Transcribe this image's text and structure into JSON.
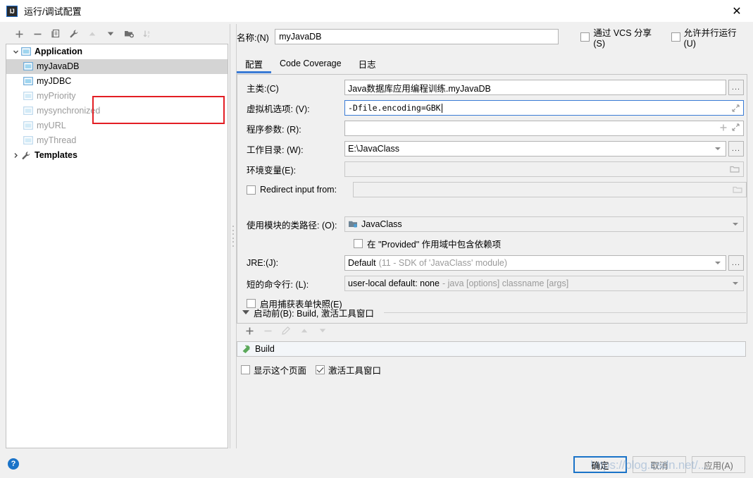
{
  "window": {
    "title": "运行/调试配置",
    "app_icon": "IJ",
    "close_icon": "✕"
  },
  "sidebar": {
    "toolbar": [
      {
        "name": "add-button",
        "icon": "plus-icon",
        "label": "+",
        "enabled": true
      },
      {
        "name": "remove-button",
        "icon": "minus-icon",
        "label": "−",
        "enabled": true
      },
      {
        "name": "copy-button",
        "icon": "copy-icon",
        "label": "copy",
        "enabled": true
      },
      {
        "name": "edit-templates-button",
        "icon": "wrench-icon",
        "label": "wrench",
        "enabled": true
      },
      {
        "name": "move-up-button",
        "icon": "arrow-up-icon",
        "label": "▲",
        "enabled": false
      },
      {
        "name": "move-down-button",
        "icon": "arrow-down-icon",
        "label": "▼",
        "enabled": true
      },
      {
        "name": "new-folder-button",
        "icon": "folder-add-icon",
        "label": "folder+",
        "enabled": true
      },
      {
        "name": "sort-button",
        "icon": "sort-alpha-icon",
        "label": "sort az",
        "enabled": false
      }
    ],
    "tree": [
      {
        "label": "Application",
        "level": 0,
        "icon": "application-icon",
        "expanded": true,
        "selected": false,
        "dim": false,
        "bold": true
      },
      {
        "label": "myJavaDB",
        "level": 1,
        "icon": "run-config-icon",
        "selected": true,
        "dim": false,
        "bold": false
      },
      {
        "label": "myJDBC",
        "level": 1,
        "icon": "run-config-icon",
        "selected": false,
        "dim": false,
        "bold": false
      },
      {
        "label": "myPriority",
        "level": 1,
        "icon": "run-config-icon",
        "selected": false,
        "dim": true,
        "bold": false
      },
      {
        "label": "mysynchronized",
        "level": 1,
        "icon": "run-config-icon",
        "selected": false,
        "dim": true,
        "bold": false
      },
      {
        "label": "myURL",
        "level": 1,
        "icon": "run-config-icon",
        "selected": false,
        "dim": true,
        "bold": false
      },
      {
        "label": "myThread",
        "level": 1,
        "icon": "run-config-icon",
        "selected": false,
        "dim": true,
        "bold": false
      },
      {
        "label": "Templates",
        "level": 0,
        "icon": "wrench-icon",
        "expanded": false,
        "selected": false,
        "dim": false,
        "bold": true
      }
    ]
  },
  "config": {
    "name_label": "名称:(N)",
    "name_value": "myJavaDB",
    "share_vcs_label": "通过 VCS 分享(S)",
    "share_vcs_checked": false,
    "allow_parallel_label": "允许并行运行(U)",
    "allow_parallel_checked": false,
    "tabs": [
      {
        "label": "配置",
        "active": true
      },
      {
        "label": "Code Coverage",
        "active": false
      },
      {
        "label": "日志",
        "active": false
      }
    ],
    "fields": {
      "main_class_label": "主类:(C)",
      "main_class_value": "Java数据库应用编程训练.myJavaDB",
      "vm_options_label": "虚拟机选项: (V):",
      "vm_options_value": "-Dfile.encoding=GBK",
      "program_args_label": "程序参数: (R):",
      "program_args_value": "",
      "working_dir_label": "工作目录: (W):",
      "working_dir_value": "E:\\JavaClass",
      "env_vars_label": "环境变量(E):",
      "env_vars_value": "",
      "redirect_input_label": "Redirect input from:",
      "redirect_input_checked": false,
      "redirect_input_value": "",
      "module_classpath_label": "使用模块的类路径: (O):",
      "module_classpath_value": "JavaClass",
      "include_provided_label": "在 \"Provided\" 作用域中包含依赖项",
      "include_provided_checked": false,
      "jre_label": "JRE:(J):",
      "jre_value": "Default",
      "jre_value_sub": "(11 - SDK of 'JavaClass' module)",
      "shorten_cmd_label": "短的命令行: (L):",
      "shorten_cmd_value": "user-local default: none",
      "shorten_cmd_sub": "- java [options] classname [args]",
      "capture_snapshot_label": "启用捕获表单快照(E)",
      "capture_snapshot_checked": false,
      "browse_button_label": "..."
    }
  },
  "before_launch": {
    "header": "启动前(B): Build, 激活工具窗口",
    "toolbar": [
      {
        "name": "add-task-button",
        "icon": "plus-icon",
        "label": "+",
        "enabled": true
      },
      {
        "name": "remove-task-button",
        "icon": "minus-icon",
        "label": "−",
        "enabled": false
      },
      {
        "name": "edit-task-button",
        "icon": "pencil-icon",
        "label": "edit",
        "enabled": false
      },
      {
        "name": "task-up-button",
        "icon": "arrow-up-icon",
        "label": "▲",
        "enabled": false
      },
      {
        "name": "task-down-button",
        "icon": "arrow-down-icon",
        "label": "▼",
        "enabled": false
      }
    ],
    "tasks": [
      {
        "label": "Build",
        "icon": "build-hammer-icon"
      }
    ],
    "show_page_label": "显示这个页面",
    "show_page_checked": false,
    "activate_tool_window_label": "激活工具窗口",
    "activate_tool_window_checked": true
  },
  "footer": {
    "help_label": "?",
    "ok_label": "确定",
    "cancel_label": "取消",
    "apply_label": "应用(A)"
  },
  "watermark": {
    "text": "https://blog.csdn.net/..."
  },
  "colors": {
    "accent": "#1a73c8",
    "tab_underline": "#3a7bd5",
    "annotation": "#e31e24",
    "selection": "#d4d4d4",
    "field_border": "#b4b4b4"
  }
}
